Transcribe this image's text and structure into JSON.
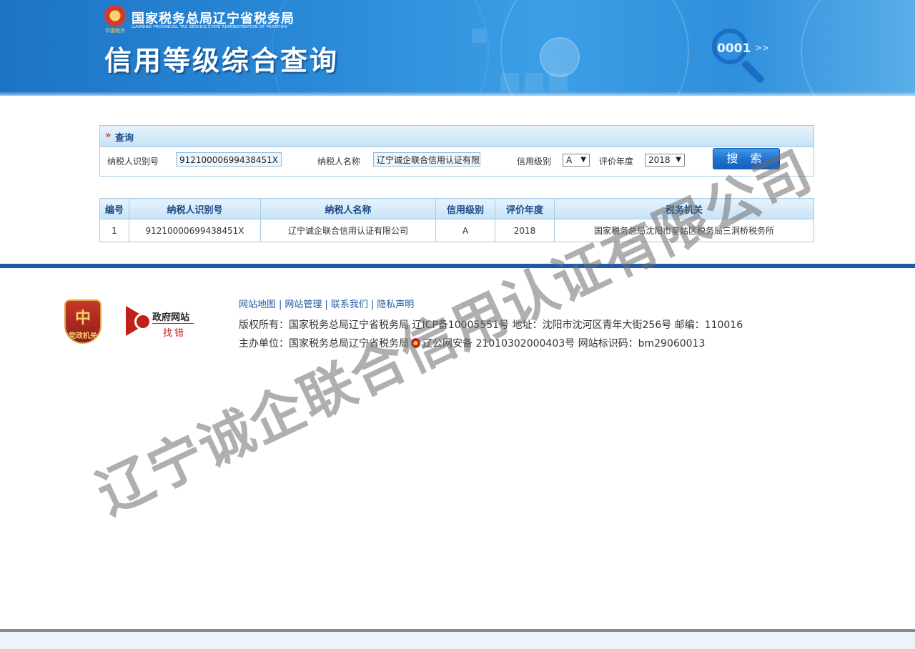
{
  "header": {
    "bureau_name": "国家税务总局辽宁省税务局",
    "bureau_english": "LIAONING PROVINCIAL TAX SERVICE,STATE ADMINISTRATION OF TAXATION",
    "emblem_subtext": "中国税务",
    "page_title": "信用等级综合查询",
    "magnifier_digits": "0001",
    "magnifier_arrows": ">>"
  },
  "query": {
    "section_label": "查询",
    "taxpayer_id_label": "纳税人识别号",
    "taxpayer_id_value": "91210000699438451X",
    "taxpayer_name_label": "纳税人名称",
    "taxpayer_name_value": "辽宁诚企联合信用认证有限公司",
    "credit_level_label": "信用级别",
    "credit_level_value": "A",
    "eval_year_label": "评价年度",
    "eval_year_value": "2018",
    "search_button": "搜 索",
    "caret": "▼"
  },
  "results": {
    "headers": [
      "编号",
      "纳税人识别号",
      "纳税人名称",
      "信用级别",
      "评价年度",
      "税务机关"
    ],
    "rows": [
      [
        "1",
        "91210000699438451X",
        "辽宁诚企联合信用认证有限公司",
        "A",
        "2018",
        "国家税务总局沈阳市皇姑区税务局三洞桥税务所"
      ]
    ]
  },
  "footer": {
    "badge_glyph": "中",
    "badge_text": "党政机关",
    "gov_site_title": "政府网站",
    "gov_site_sub": "找错",
    "links": [
      "网站地图",
      "网站管理",
      "联系我们",
      "隐私声明"
    ],
    "link_separator": "|",
    "copyright": "版权所有：国家税务总局辽宁省税务局 辽ICP备10005551号 地址：沈阳市沈河区青年大街256号 邮编：110016",
    "host_prefix": "主办单位：国家税务总局辽宁省税务局",
    "host_suffix": "辽公网安备 21010302000403号 网站标识码：bm29060013"
  },
  "watermark": "辽宁诚企联合信用认证有限公司",
  "colors": {
    "banner_blue": "#2a8ad8",
    "header_text": "#1b4b87",
    "footer_bar": "#1f5aa6",
    "search_button": "#1f6fd0",
    "accent_red": "#c0221a"
  }
}
